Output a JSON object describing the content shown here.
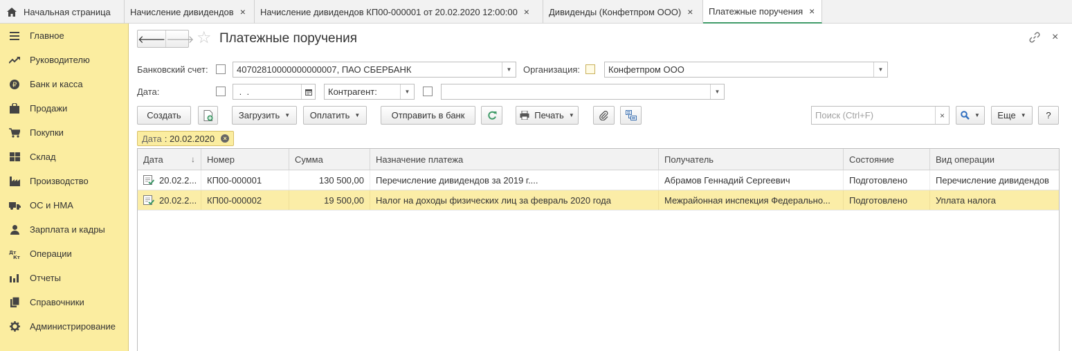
{
  "tabs": [
    {
      "label": "Начальная страница",
      "closable": false,
      "active": false
    },
    {
      "label": "Начисление дивидендов",
      "closable": true,
      "active": false
    },
    {
      "label": "Начисление дивидендов КП00-000001 от 20.02.2020 12:00:00",
      "closable": true,
      "active": false
    },
    {
      "label": "Дивиденды (Конфетпром ООО)",
      "closable": true,
      "active": false
    },
    {
      "label": "Платежные поручения",
      "closable": true,
      "active": true
    }
  ],
  "tab_close_glyph": "×",
  "sidebar": {
    "items": [
      {
        "label": "Главное",
        "icon": "menu-icon"
      },
      {
        "label": "Руководителю",
        "icon": "trend-icon"
      },
      {
        "label": "Банк и касса",
        "icon": "ruble-coin-icon"
      },
      {
        "label": "Продажи",
        "icon": "shopping-bag-icon"
      },
      {
        "label": "Покупки",
        "icon": "cart-icon"
      },
      {
        "label": "Склад",
        "icon": "warehouse-icon"
      },
      {
        "label": "Производство",
        "icon": "factory-icon"
      },
      {
        "label": "ОС и НМА",
        "icon": "truck-icon"
      },
      {
        "label": "Зарплата и кадры",
        "icon": "person-icon"
      },
      {
        "label": "Операции",
        "icon": "debit-credit-icon"
      },
      {
        "label": "Отчеты",
        "icon": "bar-chart-icon"
      },
      {
        "label": "Справочники",
        "icon": "books-icon"
      },
      {
        "label": "Администрирование",
        "icon": "gear-icon"
      }
    ]
  },
  "header": {
    "title": "Платежные поручения",
    "back": "🡐",
    "forward": "🡒",
    "star": "☆",
    "link_icon": "🔗",
    "close": "×"
  },
  "filters": {
    "bank_account_label": "Банковский счет:",
    "bank_account_value": "40702810000000000007, ПАО СБЕРБАНК",
    "org_label": "Организация:",
    "org_value": "Конфетпром ООО",
    "date_label": "Дата:",
    "date_value": " .  .",
    "counterparty_label": "Контрагент:",
    "counterparty_value": ""
  },
  "toolbar": {
    "create": "Создать",
    "load": "Загрузить",
    "pay": "Оплатить",
    "send_bank": "Отправить в банк",
    "print": "Печать",
    "search_placeholder": "Поиск (Ctrl+F)",
    "more": "Еще",
    "help": "?"
  },
  "chip": {
    "label": "Дата",
    "value": ": 20.02.2020"
  },
  "table": {
    "columns": [
      "Дата",
      "Номер",
      "Сумма",
      "Назначение платежа",
      "Получатель",
      "Состояние",
      "Вид операции"
    ],
    "sort_glyph": "↓",
    "rows": [
      {
        "date": "20.02.2...",
        "number": "КП00-000001",
        "sum": "130 500,00",
        "purpose": "Перечисление дивидендов за 2019 г....",
        "recipient": "Абрамов Геннадий Сергеевич",
        "state": "Подготовлено",
        "operation": "Перечисление дивидендов",
        "selected": false
      },
      {
        "date": "20.02.2...",
        "number": "КП00-000002",
        "sum": "19 500,00",
        "purpose": "Налог на доходы физических лиц за февраль 2020 года",
        "recipient": "Межрайонная инспекция Федерально...",
        "state": "Подготовлено",
        "operation": "Уплата налога",
        "selected": true
      }
    ]
  },
  "colors": {
    "sidebar_bg": "#fbeda0",
    "selection": "#fbeda7",
    "accent_green": "#3f9b68"
  }
}
